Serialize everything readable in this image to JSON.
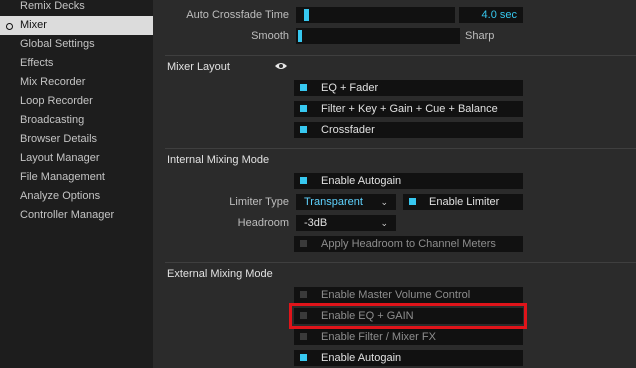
{
  "sidebar": {
    "items": [
      {
        "label": "Remix Decks",
        "selected": false
      },
      {
        "label": "Mixer",
        "selected": true
      },
      {
        "label": "Global Settings",
        "selected": false
      },
      {
        "label": "Effects",
        "selected": false
      },
      {
        "label": "Mix Recorder",
        "selected": false
      },
      {
        "label": "Loop Recorder",
        "selected": false
      },
      {
        "label": "Broadcasting",
        "selected": false
      },
      {
        "label": "Browser Details",
        "selected": false
      },
      {
        "label": "Layout Manager",
        "selected": false
      },
      {
        "label": "File Management",
        "selected": false
      },
      {
        "label": "Analyze Options",
        "selected": false
      },
      {
        "label": "Controller Manager",
        "selected": false
      }
    ]
  },
  "crossfade": {
    "time_label": "Auto Crossfade Time",
    "time_value": "4.0 sec",
    "smooth_label": "Smooth",
    "sharp_label": "Sharp"
  },
  "mixer_layout": {
    "title": "Mixer Layout",
    "eye_icon": "eye-icon",
    "options": [
      {
        "label": "EQ + Fader",
        "checked": true
      },
      {
        "label": "Filter + Key + Gain + Cue + Balance",
        "checked": true
      },
      {
        "label": "Crossfader",
        "checked": true
      }
    ]
  },
  "internal": {
    "title": "Internal Mixing Mode",
    "enable_autogain": "Enable Autogain",
    "limiter_type_label": "Limiter Type",
    "limiter_type_value": "Transparent",
    "enable_limiter": "Enable Limiter",
    "headroom_label": "Headroom",
    "headroom_value": "-3dB",
    "apply_headroom": "Apply Headroom to Channel Meters"
  },
  "external": {
    "title": "External Mixing Mode",
    "options": [
      {
        "label": "Enable Master Volume Control",
        "checked": false
      },
      {
        "label": "Enable EQ + GAIN",
        "checked": false
      },
      {
        "label": "Enable Filter / Mixer FX",
        "checked": false
      },
      {
        "label": "Enable Autogain",
        "checked": true
      }
    ]
  },
  "colors": {
    "accent": "#37c8f0",
    "highlight": "#e0141a"
  }
}
